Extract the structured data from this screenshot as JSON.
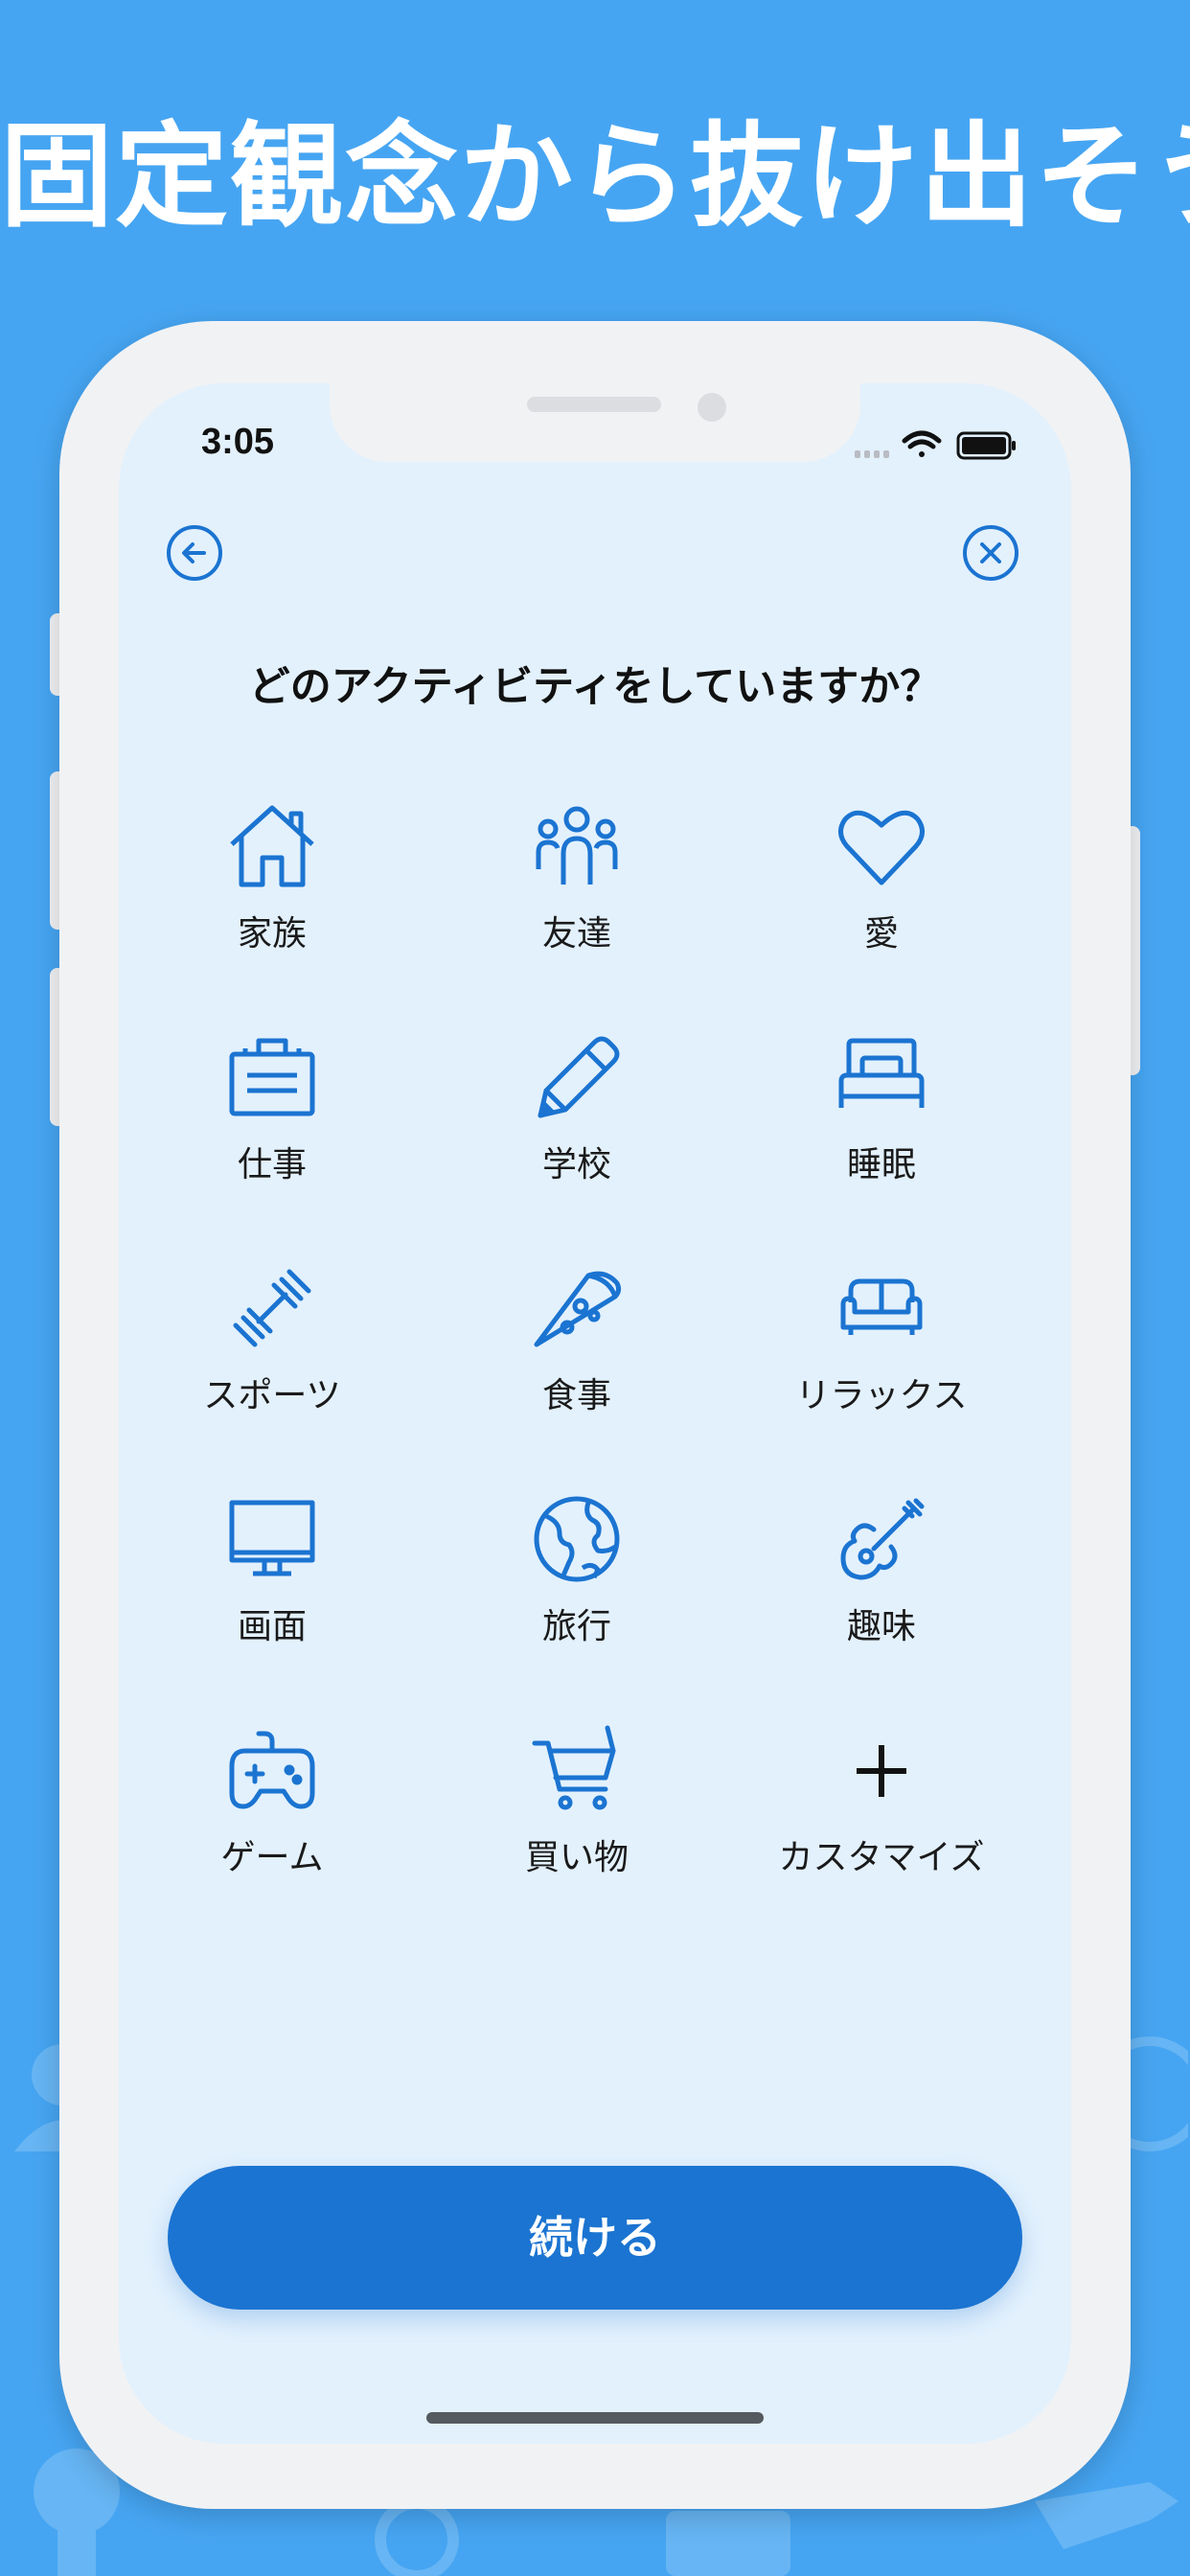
{
  "headline": "固定観念から抜け出そう",
  "status_bar": {
    "time": "3:05"
  },
  "nav": {
    "back_icon": "arrow-left-circle-icon",
    "close_icon": "x-circle-icon"
  },
  "question": "どのアクティビティをしていますか？",
  "activities": [
    {
      "label": "家族",
      "icon": "house-icon"
    },
    {
      "label": "友達",
      "icon": "people-group-icon"
    },
    {
      "label": "愛",
      "icon": "heart-icon"
    },
    {
      "label": "仕事",
      "icon": "briefcase-icon"
    },
    {
      "label": "学校",
      "icon": "pencil-icon"
    },
    {
      "label": "睡眠",
      "icon": "bed-icon"
    },
    {
      "label": "スポーツ",
      "icon": "dumbbell-icon"
    },
    {
      "label": "食事",
      "icon": "pizza-icon"
    },
    {
      "label": "リラックス",
      "icon": "sofa-icon"
    },
    {
      "label": "画面",
      "icon": "monitor-icon"
    },
    {
      "label": "旅行",
      "icon": "globe-icon"
    },
    {
      "label": "趣味",
      "icon": "guitar-icon"
    },
    {
      "label": "ゲーム",
      "icon": "gamepad-icon"
    },
    {
      "label": "買い物",
      "icon": "shopping-cart-icon"
    },
    {
      "label": "カスタマイズ",
      "icon": "plus-icon"
    }
  ],
  "continue_button": "続ける",
  "colors": {
    "background": "#46a5f2",
    "accent": "#1b74d1",
    "screen": "#e3f1fd",
    "icon": "#1b74d1"
  }
}
